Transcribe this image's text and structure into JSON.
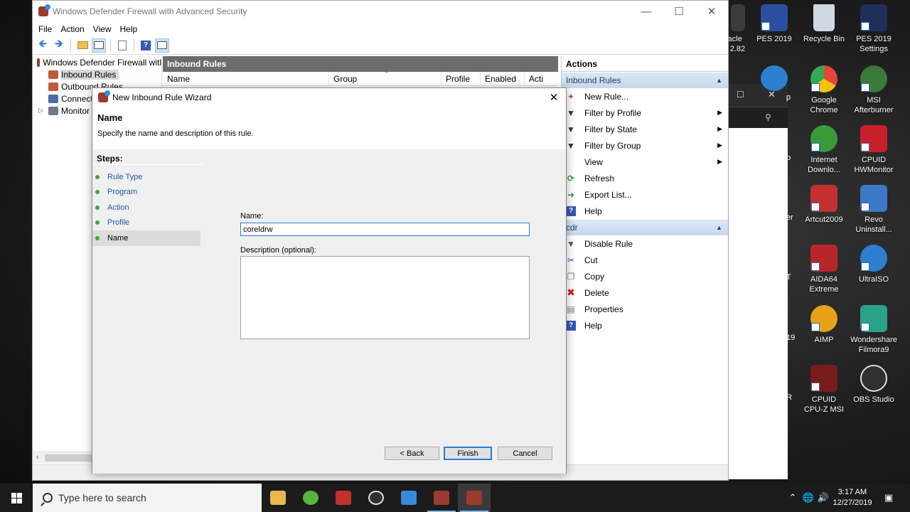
{
  "desktop": {
    "icons": [
      {
        "label": "racle\nr 2.82",
        "color": "#3b3b3b"
      },
      {
        "label": "PES 2019",
        "color": "#2b4fa0"
      },
      {
        "label": "Recycle Bin",
        "color": "#cfd8e3"
      },
      {
        "label": "PES 2019\nSettings",
        "color": "#1f2f5a"
      },
      {
        "label": "Google\nChrome",
        "color": "#e8453c"
      },
      {
        "label": "MSI\nAfterburner",
        "color": "#3a7a3a"
      },
      {
        "label": "Internet\nDownlo...",
        "color": "#3a9a3a"
      },
      {
        "label": "CPUID\nHWMonitor",
        "color": "#c8202a"
      },
      {
        "label": "Artcut2009",
        "color": "#c23030"
      },
      {
        "label": "Revo\nUninstall...",
        "color": "#3b78c7"
      },
      {
        "label": "AIDA64\nExtreme",
        "color": "#b8262a"
      },
      {
        "label": "UltraISO",
        "color": "#2f7fd0"
      },
      {
        "label": "AIMP",
        "color": "#e8a21a"
      },
      {
        "label": "Wondershare\nFilmora9",
        "color": "#2aa28a"
      },
      {
        "label": "CPUID\nCPU-Z MSI",
        "color": "#7a1c1c"
      },
      {
        "label": "OBS Studio",
        "color": "#303030"
      }
    ],
    "partial_labels": [
      "p",
      "p",
      "er",
      "T",
      "19",
      "R"
    ]
  },
  "main_window": {
    "title": "Windows Defender Firewall with Advanced Security",
    "menu": [
      "File",
      "Action",
      "View",
      "Help"
    ],
    "tree": {
      "root": "Windows Defender Firewall witl",
      "items": [
        "Inbound Rules",
        "Outbound Rules",
        "Connect",
        "Monitor"
      ]
    },
    "rules_panel": {
      "header": "Inbound Rules",
      "columns": [
        "Name",
        "Group",
        "Profile",
        "Enabled",
        "Acti"
      ]
    },
    "actions": {
      "header": "Actions",
      "section1": "Inbound Rules",
      "section1_items": [
        "New Rule...",
        "Filter by Profile",
        "Filter by State",
        "Filter by Group",
        "View",
        "Refresh",
        "Export List...",
        "Help"
      ],
      "section2": "cdr",
      "section2_items": [
        "Disable Rule",
        "Cut",
        "Copy",
        "Delete",
        "Properties",
        "Help"
      ]
    }
  },
  "wizard": {
    "title": "New Inbound Rule Wizard",
    "heading": "Name",
    "subtitle": "Specify the name and description of this rule.",
    "steps_label": "Steps:",
    "steps": [
      "Rule Type",
      "Program",
      "Action",
      "Profile",
      "Name"
    ],
    "current_step": "Name",
    "name_label": "Name:",
    "name_value": "coreldrw",
    "description_label": "Description (optional):",
    "description_value": "",
    "buttons": {
      "back": "< Back",
      "finish": "Finish",
      "cancel": "Cancel"
    }
  },
  "taskbar": {
    "search_placeholder": "Type here to search",
    "time": "3:17 AM",
    "date": "12/27/2019"
  }
}
